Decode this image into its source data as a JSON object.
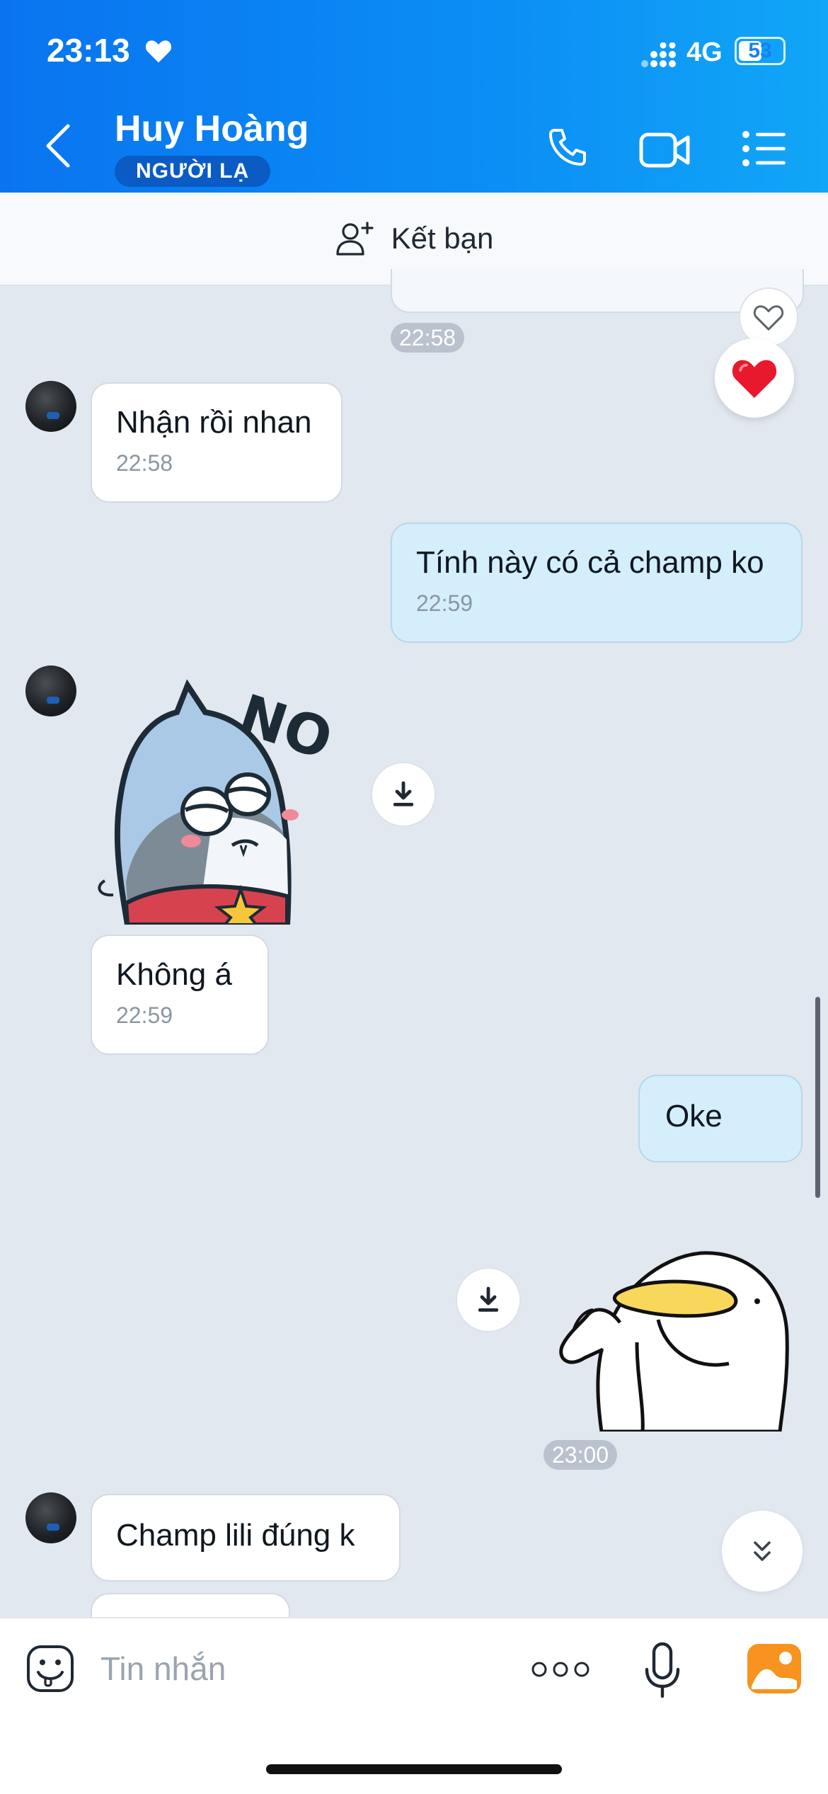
{
  "status_bar": {
    "time": "23:13",
    "network": "4G",
    "battery": "53",
    "battery_level": 0.53
  },
  "header": {
    "contact_name": "Huy Hoàng",
    "tag": "NGƯỜI LẠ"
  },
  "add_friend": {
    "label": "Kết bạn"
  },
  "messages": {
    "top_time": "22:58",
    "m1": {
      "text": "Nhận rồi nhan",
      "time": "22:58"
    },
    "m2": {
      "text": "Tính này có cả champ ko",
      "time": "22:59"
    },
    "sticker_no_text": "NO",
    "m3": {
      "text": "Không á",
      "time": "22:59"
    },
    "m4": {
      "text": "Oke"
    },
    "sticker_time": "23:00",
    "m5": {
      "text": "Champ lili đúng k"
    }
  },
  "composer": {
    "placeholder": "Tin nhắn"
  },
  "colors": {
    "header_start": "#0a74f0",
    "header_end": "#11a6f7",
    "bubble_out": "#d4eefc",
    "bubble_in": "#ffffff",
    "chat_bg": "#e2e8f0",
    "heart": "#e8182d"
  }
}
